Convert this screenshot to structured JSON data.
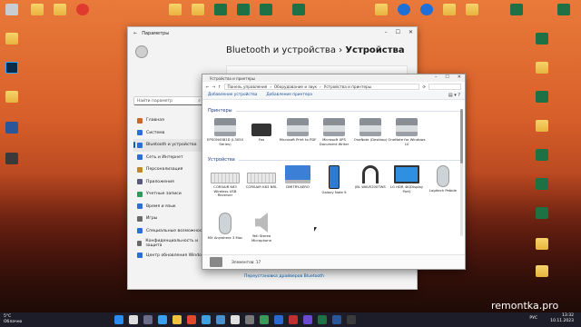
{
  "desktop": {
    "icons": [
      {
        "label": "",
        "kind": "gray"
      },
      {
        "label": "",
        "kind": "folder"
      },
      {
        "label": "",
        "kind": "folder"
      },
      {
        "label": "",
        "kind": "red"
      },
      {
        "label": "",
        "kind": "folder"
      },
      {
        "label": "",
        "kind": "folder"
      },
      {
        "label": "",
        "kind": "xls"
      },
      {
        "label": "",
        "kind": "xls"
      },
      {
        "label": "",
        "kind": "xls"
      },
      {
        "label": "",
        "kind": "xls"
      },
      {
        "label": "",
        "kind": "folder"
      },
      {
        "label": "",
        "kind": "blue"
      },
      {
        "label": "",
        "kind": "blue"
      },
      {
        "label": "",
        "kind": "folder"
      },
      {
        "label": "",
        "kind": "folder"
      },
      {
        "label": "",
        "kind": "xls"
      },
      {
        "label": "",
        "kind": "xls"
      }
    ],
    "watermark": "remontka.pro"
  },
  "settings": {
    "window_title": "Параметры",
    "search_placeholder": "Найти параметр",
    "page_title_parent": "Bluetooth и устройства",
    "page_title_sep": "›",
    "page_title_current": "Устройства",
    "nav": [
      {
        "label": "Главная",
        "color": "#c46b2a"
      },
      {
        "label": "Система",
        "color": "#2b6fd6"
      },
      {
        "label": "Bluetooth и устройства",
        "color": "#2b6fd6",
        "active": true
      },
      {
        "label": "Сеть и Интернет",
        "color": "#2b6fd6"
      },
      {
        "label": "Персонализация",
        "color": "#c0862a"
      },
      {
        "label": "Приложения",
        "color": "#5a5a7a"
      },
      {
        "label": "Учетные записи",
        "color": "#2b9a5a"
      },
      {
        "label": "Время и язык",
        "color": "#2b6fd6"
      },
      {
        "label": "Игры",
        "color": "#6a6a6a"
      },
      {
        "label": "Специальные возможности",
        "color": "#2b6fd6"
      },
      {
        "label": "Конфиденциальность и защита",
        "color": "#6a6a6a"
      },
      {
        "label": "Центр обновления Windows",
        "color": "#2b6fd6"
      }
    ],
    "bottom_link": "Переустановка драйверов Bluetooth"
  },
  "devices": {
    "window_title": "Устройства и принтеры",
    "breadcrumb": [
      "Панель управления",
      "Оборудование и звук",
      "Устройства и принтеры"
    ],
    "commands": [
      "Добавление устройства",
      "Добавление принтера"
    ],
    "printers_header": "Принтеры",
    "devices_header": "Устройства",
    "printers": [
      {
        "label": "EPSON4581D (L3050 Series)",
        "kind": "printer"
      },
      {
        "label": "Fax",
        "kind": "fax"
      },
      {
        "label": "Microsoft Print to PDF",
        "kind": "printer"
      },
      {
        "label": "Microsoft XPS Document Writer",
        "kind": "printer"
      },
      {
        "label": "OneNote (Desktop)",
        "kind": "printer"
      },
      {
        "label": "OneNote for Windows 10",
        "kind": "printer"
      }
    ],
    "devices": [
      {
        "label": "CORSAIR K63 Wireless USB Receiver",
        "kind": "kbd"
      },
      {
        "label": "CORSAIR K63 NRL",
        "kind": "kbd"
      },
      {
        "label": "DMITRY-AERO",
        "kind": "laptop"
      },
      {
        "label": "Galaxy Note 9",
        "kind": "phone"
      },
      {
        "label": "JBL WAVE200TWS",
        "kind": "headset"
      },
      {
        "label": "LG HDR 4K(Display Port)",
        "kind": "monitor"
      },
      {
        "label": "Logitech Pebble",
        "kind": "mouse"
      },
      {
        "label": "MX Anywhere 3 Mac",
        "kind": "mouse"
      },
      {
        "label": "Yeti Stereo Microphone",
        "kind": "speaker"
      }
    ],
    "status": "Элементов: 17"
  },
  "taskbar": {
    "weather_temp": "5°C",
    "weather_desc": "Облачно",
    "lang": "РУС",
    "time": "13:32",
    "date": "10.11.2023"
  }
}
